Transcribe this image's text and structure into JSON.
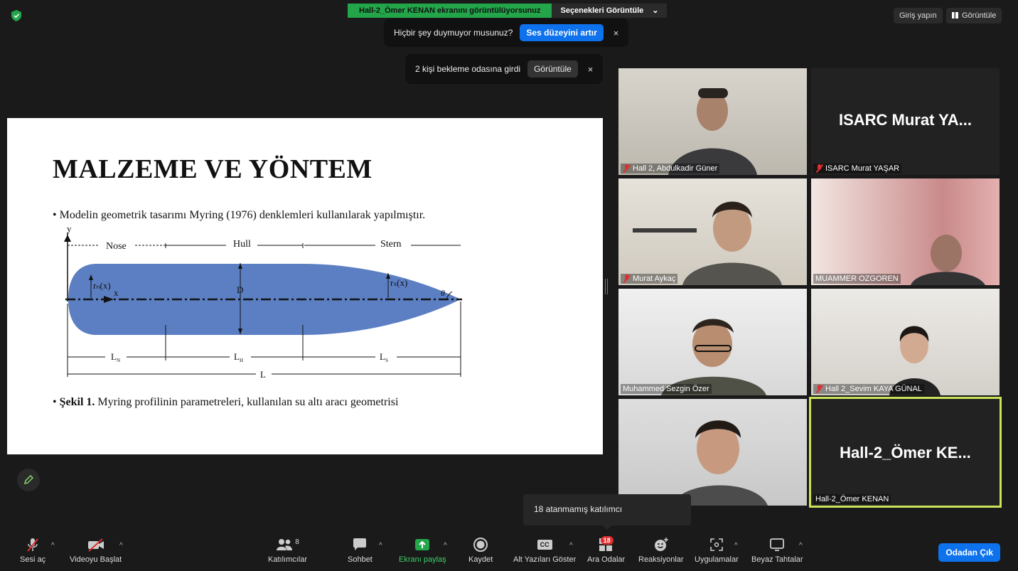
{
  "share_banner": {
    "text": "Hall-2_Ömer KENAN ekranını görüntülüyorsunuz",
    "options": "Seçenekleri Görüntüle",
    "caret": "⌄"
  },
  "top_right": {
    "signin": "Giriş yapın",
    "view": "Görüntüle"
  },
  "notif_audio": {
    "text": "Hiçbir şey duymuyor musunuz?",
    "button": "Ses düzeyini artır",
    "close": "×"
  },
  "notif_waiting": {
    "text": "2 kişi bekleme odasına girdi",
    "button": "Görüntüle",
    "close": "×"
  },
  "slide": {
    "title": "MALZEME VE YÖNTEM",
    "bullet1": "• Modelin geometrik tasarımı Myring (1976) denklemleri kullanılarak yapılmıştır.",
    "bullet2_bold": "Şekil 1.",
    "bullet2_rest": " Myring profilinin parametreleri, kullanılan su altı aracı geometrisi",
    "bullet2_dot": "• ",
    "diagram": {
      "y": "y",
      "x": "x",
      "nose": "Nose",
      "hull": "Hull",
      "stern": "Stern",
      "rn": "rₙ(x)",
      "rs": "rₛ(x)",
      "d": "D",
      "theta": "θ",
      "ln": "L",
      "ln_sub": "N",
      "lh": "L",
      "lh_sub": "H",
      "ls": "L",
      "ls_sub": "S",
      "l": "L"
    }
  },
  "participants": [
    {
      "name": "Hall 2, Abdulkadir Güner",
      "muted": true,
      "video": true
    },
    {
      "name": "ISARC Murat YAŞAR",
      "muted": true,
      "video": false,
      "big": "ISARC Murat YA..."
    },
    {
      "name": "Murat Aykaç",
      "muted": true,
      "video": true
    },
    {
      "name": "MUAMMER OZGOREN",
      "muted": false,
      "video": true
    },
    {
      "name": "Muhammed Sezgin Özer",
      "muted": false,
      "video": true
    },
    {
      "name": "Hall 2_Sevim KAYA GÜNAL",
      "muted": true,
      "video": true
    },
    {
      "name": "",
      "muted": false,
      "video": true
    },
    {
      "name": "Hall-2_Ömer KENAN",
      "muted": false,
      "video": false,
      "big": "Hall-2_Ömer  KE..."
    }
  ],
  "tooltip": "18 atanmamış katılımcı",
  "toolbar": {
    "unmute": "Sesi aç",
    "start_video": "Videoyu Başlat",
    "participants": "Katılımcılar",
    "participants_count": "8",
    "chat": "Sohbet",
    "share": "Ekranı paylaş",
    "record": "Kaydet",
    "captions": "Alt Yazıları Göster",
    "captions_icon": "CC",
    "breakout": "Ara Odalar",
    "breakout_badge": "18",
    "reactions": "Reaksiyonlar",
    "apps": "Uygulamalar",
    "whiteboard": "Beyaz Tahtalar",
    "leave": "Odadan Çık",
    "caret": "^"
  },
  "colors": {
    "share_green": "#23a54a",
    "zoom_blue": "#0e72ed",
    "active_border": "#c9e35a",
    "hull_blue": "#5b7fc2",
    "muted_red": "#e02f2f"
  }
}
